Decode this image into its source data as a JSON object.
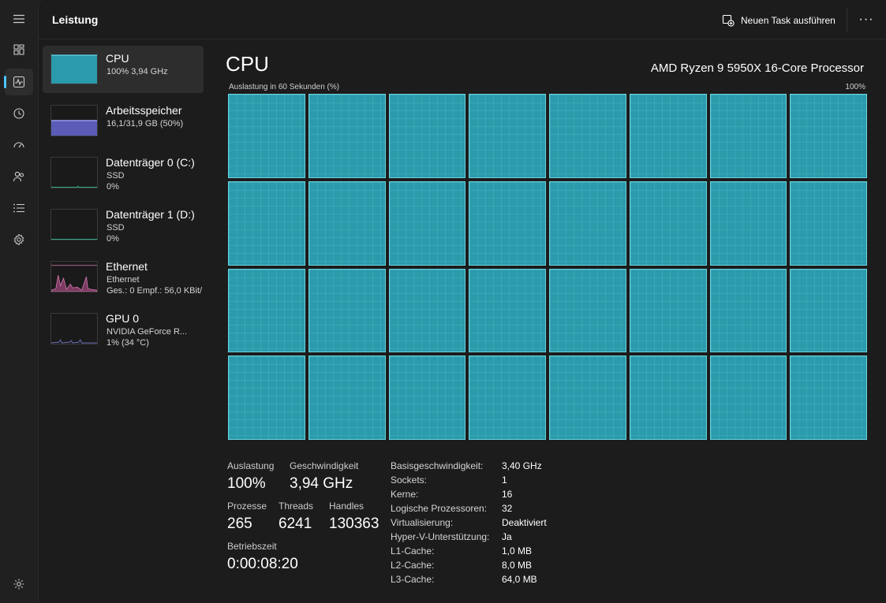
{
  "header": {
    "title": "Leistung",
    "run_task_label": "Neuen Task ausführen",
    "more_label": "···"
  },
  "rail": {
    "items": [
      "menu",
      "processes",
      "performance",
      "app-history",
      "startup",
      "users",
      "details",
      "services"
    ],
    "settings": "settings"
  },
  "devices": [
    {
      "name": "CPU",
      "line1": "100%  3,94 GHz",
      "line2": "",
      "color": "#36a2b3"
    },
    {
      "name": "Arbeitsspeicher",
      "line1": "16,1/31,9 GB (50%)",
      "line2": "",
      "color": "#6e6fd6"
    },
    {
      "name": "Datenträger 0 (C:)",
      "line1": "SSD",
      "line2": "0%",
      "color": "#38a88a"
    },
    {
      "name": "Datenträger 1 (D:)",
      "line1": "SSD",
      "line2": "0%",
      "color": "#38a88a"
    },
    {
      "name": "Ethernet",
      "line1": "Ethernet",
      "line2": "Ges.: 0 Empf.: 56,0 KBit/",
      "color": "#d87ab0"
    },
    {
      "name": "GPU 0",
      "line1": "NVIDIA GeForce R...",
      "line2": "1%  (34 °C)",
      "color": "#7a78d0"
    }
  ],
  "detail": {
    "title": "CPU",
    "model": "AMD Ryzen 9 5950X 16-Core Processor",
    "graph_label": "Auslastung in 60 Sekunden (%)",
    "graph_max": "100%",
    "core_count": 32,
    "core_utilization": 1.0,
    "core_color": "#2a9bab"
  },
  "stats": {
    "utilization_label": "Auslastung",
    "utilization_value": "100%",
    "speed_label": "Geschwindigkeit",
    "speed_value": "3,94 GHz",
    "processes_label": "Prozesse",
    "processes_value": "265",
    "threads_label": "Threads",
    "threads_value": "6241",
    "handles_label": "Handles",
    "handles_value": "130363",
    "uptime_label": "Betriebszeit",
    "uptime_value": "0:00:08:20"
  },
  "specs": [
    {
      "label": "Basisgeschwindigkeit:",
      "value": "3,40 GHz"
    },
    {
      "label": "Sockets:",
      "value": "1"
    },
    {
      "label": "Kerne:",
      "value": "16"
    },
    {
      "label": "Logische Prozessoren:",
      "value": "32"
    },
    {
      "label": "Virtualisierung:",
      "value": "Deaktiviert"
    },
    {
      "label": "Hyper-V-Unterstützung:",
      "value": "Ja"
    },
    {
      "label": "L1-Cache:",
      "value": "1,0 MB"
    },
    {
      "label": "L2-Cache:",
      "value": "8,0 MB"
    },
    {
      "label": "L3-Cache:",
      "value": "64,0 MB"
    }
  ]
}
